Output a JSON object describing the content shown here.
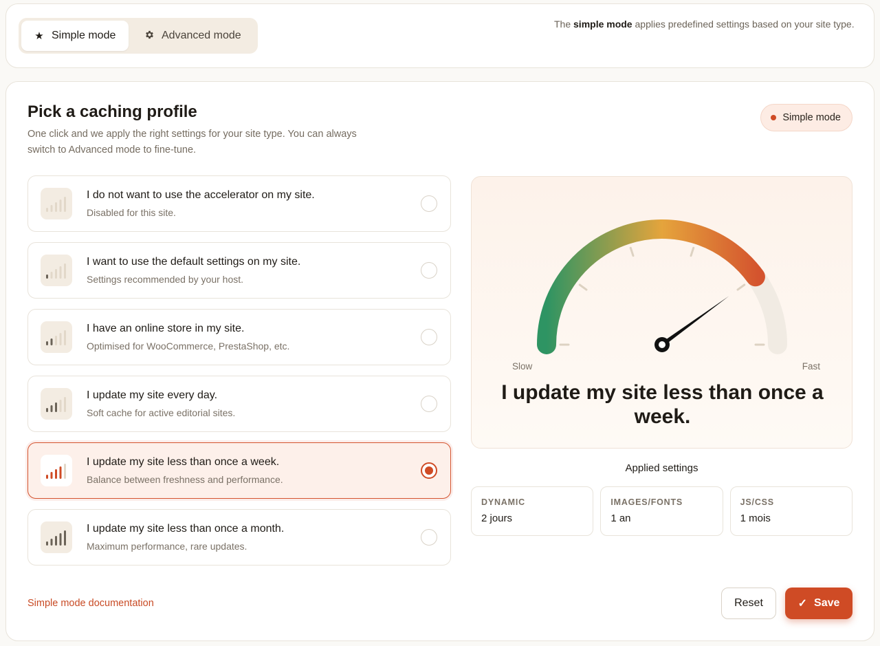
{
  "mode_switch": {
    "simple_label": "Simple mode",
    "advanced_label": "Advanced mode",
    "simple_icon": "star-icon",
    "advanced_icon": "gear-icon"
  },
  "top_description": {
    "prefix": "The ",
    "bold": "simple mode",
    "suffix": " applies predefined settings based on your site type."
  },
  "page": {
    "title": "Pick a caching profile",
    "subtitle": "One click and we apply the right settings for your site type. You can always switch to Advanced mode to fine-tune.",
    "badge": "Simple mode"
  },
  "options": [
    {
      "title": "I do not want to use the accelerator on my site.",
      "desc": "Disabled for this site.",
      "level": 0,
      "selected": false
    },
    {
      "title": "I want to use the default settings on my site.",
      "desc": "Settings recommended by your host.",
      "level": 1,
      "selected": false
    },
    {
      "title": "I have an online store in my site.",
      "desc": "Optimised for WooCommerce, PrestaShop, etc.",
      "level": 2,
      "selected": false
    },
    {
      "title": "I update my site every day.",
      "desc": "Soft cache for active editorial sites.",
      "level": 3,
      "selected": false
    },
    {
      "title": "I update my site less than once a week.",
      "desc": "Balance between freshness and performance.",
      "level": 4,
      "selected": true
    },
    {
      "title": "I update my site less than once a month.",
      "desc": "Maximum performance, rare updates.",
      "level": 5,
      "selected": false
    }
  ],
  "gauge": {
    "slow_label": "Slow",
    "fast_label": "Fast",
    "caption": "I update my site less than once a week.",
    "value_fraction": 0.8,
    "colors": {
      "green": "#2e9463",
      "amber": "#e5a43c",
      "red": "#d4532e",
      "track": "#f1ebe3"
    }
  },
  "applied": {
    "title": "Applied settings",
    "items": [
      {
        "label": "DYNAMIC",
        "value": "2 jours"
      },
      {
        "label": "IMAGES/FONTS",
        "value": "1 an"
      },
      {
        "label": "JS/CSS",
        "value": "1 mois"
      }
    ]
  },
  "footer": {
    "doc_link": "Simple mode documentation",
    "reset_label": "Reset",
    "save_label": "Save",
    "save_icon": "check-icon"
  },
  "colors": {
    "accent": "#cf4b25",
    "bar_active": "#cf4b25",
    "bar_on": "#6b6358",
    "bar_off": "#e2d8c9"
  }
}
